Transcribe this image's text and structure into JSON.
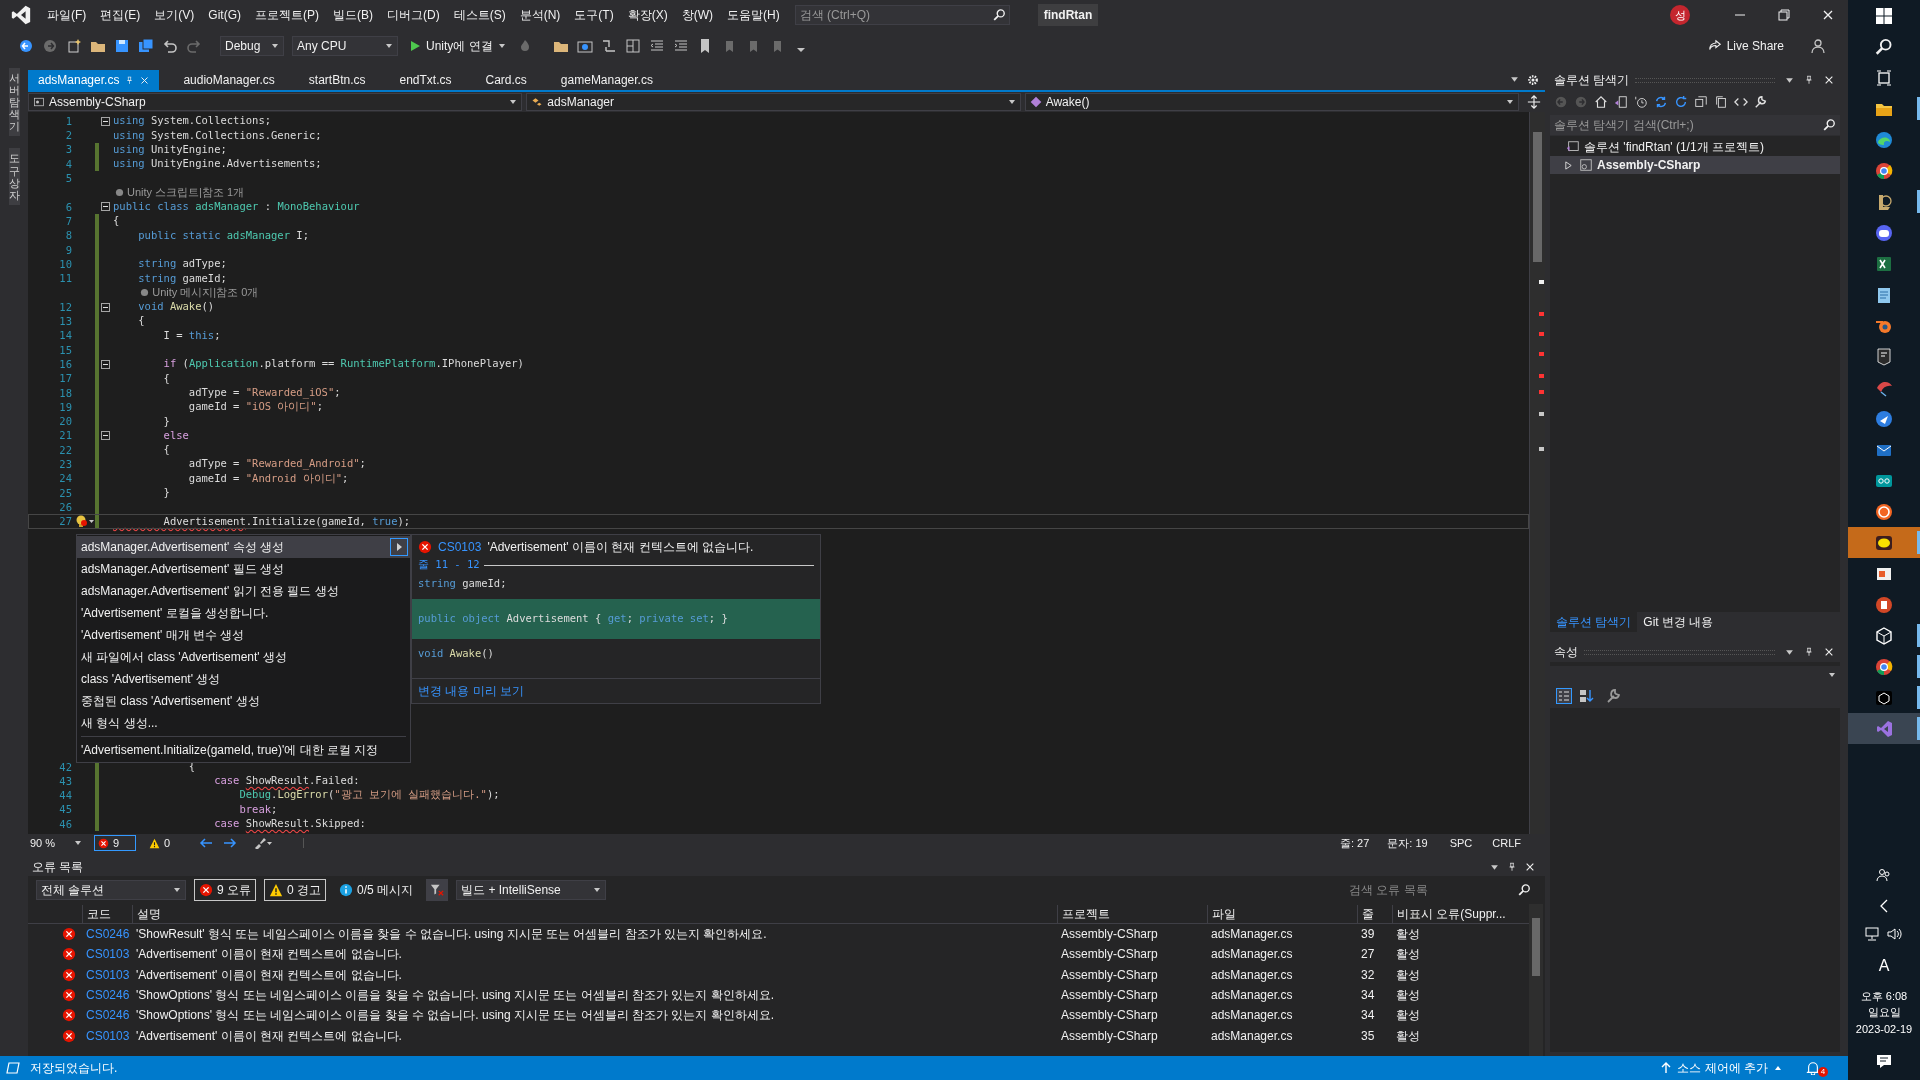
{
  "menu_bar": {
    "items": [
      "파일(F)",
      "편집(E)",
      "보기(V)",
      "Git(G)",
      "프로젝트(P)",
      "빌드(B)",
      "디버그(D)",
      "테스트(S)",
      "분석(N)",
      "도구(T)",
      "확장(X)",
      "창(W)",
      "도움말(H)"
    ],
    "search_placeholder": "검색 (Ctrl+Q)",
    "title": "findRtan",
    "avatar": "성"
  },
  "toolbar": {
    "configuration": "Debug",
    "platform": "Any CPU",
    "run": "Unity에 연결",
    "live_share": "Live Share"
  },
  "side_tabs": [
    "서버 탐색기",
    "도구 상자"
  ],
  "editor": {
    "tabs": [
      {
        "label": "adsManager.cs",
        "selected": true
      },
      {
        "label": "audioManager.cs",
        "selected": false
      },
      {
        "label": "startBtn.cs",
        "selected": false
      },
      {
        "label": "endTxt.cs",
        "selected": false
      },
      {
        "label": "Card.cs",
        "selected": false
      },
      {
        "label": "gameManager.cs",
        "selected": false
      }
    ],
    "nav": [
      "Assembly-CSharp",
      "adsManager",
      "Awake()"
    ],
    "code_top": [
      {
        "kind": "code",
        "number": "1",
        "changed": false,
        "fold": true,
        "tokens": [
          {
            "kind": "kw",
            "text": "using"
          },
          {
            "kind": "plain",
            "text": " System.Collections;"
          }
        ]
      },
      {
        "kind": "code",
        "number": "2",
        "changed": false,
        "fold": false,
        "tokens": [
          {
            "kind": "kw",
            "text": "using"
          },
          {
            "kind": "plain",
            "text": " System.Collections.Generic;"
          }
        ]
      },
      {
        "kind": "code",
        "number": "3",
        "changed": true,
        "fold": false,
        "tokens": [
          {
            "kind": "kw",
            "text": "using"
          },
          {
            "kind": "plain",
            "text": " UnityEngine;"
          }
        ]
      },
      {
        "kind": "code",
        "number": "4",
        "changed": true,
        "fold": false,
        "tokens": [
          {
            "kind": "kw",
            "text": "using"
          },
          {
            "kind": "plain",
            "text": " UnityEngine.Advertisements;"
          }
        ]
      },
      {
        "kind": "code",
        "number": "5",
        "changed": false,
        "fold": false
      },
      {
        "kind": "lens",
        "changed": false,
        "text": "Unity 스크립트|참조 1개"
      },
      {
        "kind": "code",
        "number": "6",
        "changed": false,
        "fold": true,
        "tokens": [
          {
            "kind": "kw",
            "text": "public class "
          },
          {
            "kind": "type",
            "text": "adsManager"
          },
          {
            "kind": "plain",
            "text": " : "
          },
          {
            "kind": "type",
            "text": "MonoBehaviour"
          }
        ]
      },
      {
        "kind": "code",
        "number": "7",
        "changed": true,
        "fold": false,
        "tokens": [
          {
            "kind": "plain",
            "text": "{"
          }
        ]
      },
      {
        "kind": "code",
        "number": "8",
        "changed": true,
        "fold": false,
        "tokens": [
          {
            "kind": "kw",
            "text": "    public static "
          },
          {
            "kind": "type",
            "text": "adsManager"
          },
          {
            "kind": "plain",
            "text": " I;"
          }
        ]
      },
      {
        "kind": "code",
        "number": "9",
        "changed": true,
        "fold": false
      },
      {
        "kind": "code",
        "number": "10",
        "changed": true,
        "fold": false,
        "tokens": [
          {
            "kind": "kw",
            "text": "    string"
          },
          {
            "kind": "plain",
            "text": " adType;"
          }
        ]
      },
      {
        "kind": "code",
        "number": "11",
        "changed": true,
        "fold": false,
        "tokens": [
          {
            "kind": "kw",
            "text": "    string"
          },
          {
            "kind": "plain",
            "text": " gameId;"
          }
        ]
      },
      {
        "kind": "lens",
        "changed": true,
        "text": "    Unity 메시지|참조 0개"
      },
      {
        "kind": "code",
        "number": "12",
        "changed": true,
        "fold": true,
        "tokens": [
          {
            "kind": "kw",
            "text": "    void "
          },
          {
            "kind": "fn",
            "text": "Awake"
          },
          {
            "kind": "plain",
            "text": "()"
          }
        ]
      },
      {
        "kind": "code",
        "number": "13",
        "changed": true,
        "fold": false,
        "tokens": [
          {
            "kind": "plain",
            "text": "    {"
          }
        ]
      },
      {
        "kind": "code",
        "number": "14",
        "changed": true,
        "fold": false,
        "tokens": [
          {
            "kind": "plain",
            "text": "        I = "
          },
          {
            "kind": "kw",
            "text": "this"
          },
          {
            "kind": "plain",
            "text": ";"
          }
        ]
      },
      {
        "kind": "code",
        "number": "15",
        "changed": true,
        "fold": false
      },
      {
        "kind": "code",
        "number": "16",
        "changed": true,
        "fold": true,
        "tokens": [
          {
            "kind": "ctl",
            "text": "        if"
          },
          {
            "kind": "plain",
            "text": " ("
          },
          {
            "kind": "type",
            "text": "Application"
          },
          {
            "kind": "plain",
            "text": ".platform == "
          },
          {
            "kind": "type",
            "text": "RuntimePlatform"
          },
          {
            "kind": "plain",
            "text": ".IPhonePlayer)"
          }
        ]
      },
      {
        "kind": "code",
        "number": "17",
        "changed": true,
        "fold": false,
        "tokens": [
          {
            "kind": "plain",
            "text": "        {"
          }
        ]
      },
      {
        "kind": "code",
        "number": "18",
        "changed": true,
        "fold": false,
        "tokens": [
          {
            "kind": "plain",
            "text": "            adType = "
          },
          {
            "kind": "str",
            "text": "\"Rewarded_iOS\""
          },
          {
            "kind": "plain",
            "text": ";"
          }
        ]
      },
      {
        "kind": "code",
        "number": "19",
        "changed": true,
        "fold": false,
        "tokens": [
          {
            "kind": "plain",
            "text": "            gameId = "
          },
          {
            "kind": "str",
            "text": "\"iOS 아이디\""
          },
          {
            "kind": "plain",
            "text": ";"
          }
        ]
      },
      {
        "kind": "code",
        "number": "20",
        "changed": true,
        "fold": false,
        "tokens": [
          {
            "kind": "plain",
            "text": "        }"
          }
        ]
      },
      {
        "kind": "code",
        "number": "21",
        "changed": true,
        "fold": true,
        "tokens": [
          {
            "kind": "ctl",
            "text": "        else"
          }
        ]
      },
      {
        "kind": "code",
        "number": "22",
        "changed": true,
        "fold": false,
        "tokens": [
          {
            "kind": "plain",
            "text": "        {"
          }
        ]
      },
      {
        "kind": "code",
        "number": "23",
        "changed": true,
        "fold": false,
        "tokens": [
          {
            "kind": "plain",
            "text": "            adType = "
          },
          {
            "kind": "str",
            "text": "\"Rewarded_Android\""
          },
          {
            "kind": "plain",
            "text": ";"
          }
        ]
      },
      {
        "kind": "code",
        "number": "24",
        "changed": true,
        "fold": false,
        "tokens": [
          {
            "kind": "plain",
            "text": "            gameId = "
          },
          {
            "kind": "str",
            "text": "\"Android 아이디\""
          },
          {
            "kind": "plain",
            "text": ";"
          }
        ]
      },
      {
        "kind": "code",
        "number": "25",
        "changed": true,
        "fold": false,
        "tokens": [
          {
            "kind": "plain",
            "text": "        }"
          }
        ]
      },
      {
        "kind": "code",
        "number": "26",
        "changed": true,
        "fold": false
      },
      {
        "kind": "code",
        "number": "27",
        "changed": true,
        "fold": false,
        "tokens": [
          {
            "kind": "err",
            "text": "        Advertisement"
          },
          {
            "kind": "plain",
            "text": ".Initialize(gameId, "
          },
          {
            "kind": "kw",
            "text": "true"
          },
          {
            "kind": "plain",
            "text": ");"
          }
        ]
      }
    ],
    "code_bottom": [
      {
        "kind": "code",
        "number": "42",
        "changed": true,
        "fold": false,
        "tokens": [
          {
            "kind": "plain",
            "text": "            {"
          }
        ]
      },
      {
        "kind": "code",
        "number": "43",
        "changed": true,
        "fold": false,
        "tokens": [
          {
            "kind": "ctl",
            "text": "                case "
          },
          {
            "kind": "err",
            "text": "ShowResult"
          },
          {
            "kind": "plain",
            "text": ".Failed:"
          }
        ]
      },
      {
        "kind": "code",
        "number": "44",
        "changed": true,
        "fold": false,
        "tokens": [
          {
            "kind": "type",
            "text": "                    Debug"
          },
          {
            "kind": "plain",
            "text": "."
          },
          {
            "kind": "fn",
            "text": "LogError"
          },
          {
            "kind": "plain",
            "text": "("
          },
          {
            "kind": "str",
            "text": "\"광고 보기에 실패했습니다.\""
          },
          {
            "kind": "plain",
            "text": ");"
          }
        ]
      },
      {
        "kind": "code",
        "number": "45",
        "changed": true,
        "fold": false,
        "tokens": [
          {
            "kind": "ctl",
            "text": "                    break"
          },
          {
            "kind": "plain",
            "text": ";"
          }
        ]
      },
      {
        "kind": "code",
        "number": "46",
        "changed": true,
        "fold": false,
        "tokens": [
          {
            "kind": "ctl",
            "text": "                case "
          },
          {
            "kind": "err",
            "text": "ShowResult"
          },
          {
            "kind": "plain",
            "text": ".Skipped:"
          }
        ]
      }
    ],
    "quick_actions": {
      "items": [
        {
          "label": "adsManager.Advertisement' 속성 생성",
          "selected": true
        },
        {
          "label": "adsManager.Advertisement' 필드 생성",
          "selected": false
        },
        {
          "label": "adsManager.Advertisement' 읽기 전용 필드 생성",
          "selected": false
        },
        {
          "label": "'Advertisement' 로컬을 생성합니다.",
          "selected": false
        },
        {
          "label": "'Advertisement' 매개 변수 생성",
          "selected": false
        },
        {
          "label": "새 파일에서 class 'Advertisement' 생성",
          "selected": false
        },
        {
          "label": "class 'Advertisement' 생성",
          "selected": false
        },
        {
          "label": "중첩된 class 'Advertisement' 생성",
          "selected": false
        },
        {
          "label": "새 형식 생성...",
          "selected": false
        }
      ],
      "footer_item": "'Advertisement.Initialize(gameId, true)'에 대한 로컬 지정",
      "preview": {
        "code": "CS0103",
        "message": "'Advertisement' 이름이 현재 컨텍스트에 없습니다.",
        "range": "줄 11 - 12",
        "lines": [
          {
            "added": false,
            "tokens": [
              {
                "kind": "kw",
                "text": "string"
              },
              {
                "kind": "plain",
                "text": " gameId;"
              }
            ]
          },
          {
            "added": true,
            "tokens": [
              {
                "kind": "kw",
                "text": "public object"
              },
              {
                "kind": "plain",
                "text": " Advertisement { "
              },
              {
                "kind": "kw",
                "text": "get"
              },
              {
                "kind": "plain",
                "text": "; "
              },
              {
                "kind": "kw",
                "text": "private set"
              },
              {
                "kind": "plain",
                "text": "; }"
              }
            ]
          },
          {
            "added": false,
            "tokens": [
              {
                "kind": "kw",
                "text": "void "
              },
              {
                "kind": "fn",
                "text": "Awake"
              },
              {
                "kind": "plain",
                "text": "()"
              }
            ]
          }
        ],
        "link": "변경 내용 미리 보기"
      }
    },
    "status": {
      "zoom": "90 %",
      "errors": "9",
      "warnings": "0",
      "line": "줄: 27",
      "column": "문자: 19",
      "spacing": "SPC",
      "line_ending": "CRLF"
    }
  },
  "error_list": {
    "title": "오류 목록",
    "scope": "전체 솔루션",
    "filters": [
      {
        "kind": "error",
        "label": "9 오류",
        "selected": true
      },
      {
        "kind": "warning",
        "label": "0 경고",
        "selected": true
      },
      {
        "kind": "info",
        "label": "0/5 메시지",
        "selected": false
      }
    ],
    "source": "빌드 + IntelliSense",
    "search_placeholder": "검색 오류 목록",
    "columns": [
      "코드",
      "설명",
      "프로젝트",
      "파일",
      "줄",
      "비표시 오류(Suppr..."
    ],
    "rows": [
      {
        "code": "CS0246",
        "description": "'ShowResult' 형식 또는 네임스페이스 이름을 찾을 수 없습니다. using 지시문 또는 어셈블리 참조가 있는지 확인하세요.",
        "project": "Assembly-CSharp",
        "file": "adsManager.cs",
        "line": "39",
        "suppression": "활성"
      },
      {
        "code": "CS0103",
        "description": "'Advertisement' 이름이 현재 컨텍스트에 없습니다.",
        "project": "Assembly-CSharp",
        "file": "adsManager.cs",
        "line": "27",
        "suppression": "활성"
      },
      {
        "code": "CS0103",
        "description": "'Advertisement' 이름이 현재 컨텍스트에 없습니다.",
        "project": "Assembly-CSharp",
        "file": "adsManager.cs",
        "line": "32",
        "suppression": "활성"
      },
      {
        "code": "CS0246",
        "description": "'ShowOptions' 형식 또는 네임스페이스 이름을 찾을 수 없습니다. using 지시문 또는 어셈블리 참조가 있는지 확인하세요.",
        "project": "Assembly-CSharp",
        "file": "adsManager.cs",
        "line": "34",
        "suppression": "활성"
      },
      {
        "code": "CS0246",
        "description": "'ShowOptions' 형식 또는 네임스페이스 이름을 찾을 수 없습니다. using 지시문 또는 어셈블리 참조가 있는지 확인하세요.",
        "project": "Assembly-CSharp",
        "file": "adsManager.cs",
        "line": "34",
        "suppression": "활성"
      },
      {
        "code": "CS0103",
        "description": "'Advertisement' 이름이 현재 컨텍스트에 없습니다.",
        "project": "Assembly-CSharp",
        "file": "adsManager.cs",
        "line": "35",
        "suppression": "활성"
      }
    ]
  },
  "solution_explorer": {
    "title": "솔루션 탐색기",
    "search_placeholder": "솔루션 탐색기 검색(Ctrl+;)",
    "tree": [
      {
        "label": "솔루션 'findRtan' (1/1개 프로젝트)",
        "selected": false,
        "children": [
          {
            "label": "Assembly-CSharp",
            "selected": true,
            "expanded": false
          }
        ]
      }
    ],
    "tabs": [
      {
        "label": "솔루션 탐색기",
        "selected": true
      },
      {
        "label": "Git 변경 내용",
        "selected": false
      }
    ]
  },
  "properties": {
    "title": "속성"
  },
  "status_bar": {
    "message": "저장되었습니다.",
    "source_control": "소스 제어에 추가",
    "notifications": "4"
  },
  "taskbar": {
    "apps": [
      {
        "kind": "folder",
        "running": true,
        "flashing": false,
        "selected": false
      },
      {
        "kind": "edge",
        "running": false,
        "flashing": false,
        "selected": false
      },
      {
        "kind": "chrome",
        "running": false,
        "flashing": false,
        "selected": false
      },
      {
        "kind": "league",
        "running": true,
        "flashing": false,
        "selected": false
      },
      {
        "kind": "discord",
        "running": false,
        "flashing": false,
        "selected": false
      },
      {
        "kind": "excel",
        "running": false,
        "flashing": false,
        "selected": false
      },
      {
        "kind": "notepad",
        "running": false,
        "flashing": false,
        "selected": false
      },
      {
        "kind": "blender",
        "running": false,
        "flashing": false,
        "selected": false
      },
      {
        "kind": "epic",
        "running": false,
        "flashing": false,
        "selected": false
      },
      {
        "kind": "kite",
        "running": false,
        "flashing": false,
        "selected": false
      },
      {
        "kind": "shuttle",
        "running": false,
        "flashing": false,
        "selected": false
      },
      {
        "kind": "mail",
        "running": false,
        "flashing": false,
        "selected": false
      },
      {
        "kind": "arduino",
        "running": false,
        "flashing": false,
        "selected": false
      },
      {
        "kind": "letter",
        "running": false,
        "flashing": false,
        "selected": false
      },
      {
        "kind": "chat",
        "running": true,
        "flashing": true,
        "selected": false
      },
      {
        "kind": "slides",
        "running": false,
        "flashing": false,
        "selected": false
      },
      {
        "kind": "powerpoint",
        "running": false,
        "flashing": false,
        "selected": false
      },
      {
        "kind": "cube",
        "running": true,
        "flashing": false,
        "selected": false
      },
      {
        "kind": "chrome",
        "running": true,
        "flashing": false,
        "selected": false
      },
      {
        "kind": "unityhub",
        "running": true,
        "flashing": false,
        "selected": false
      },
      {
        "kind": "visualstudio",
        "running": true,
        "flashing": false,
        "selected": true
      }
    ],
    "ime": "A",
    "time": "오후 6:08",
    "day": "일요일",
    "date": "2023-02-19"
  }
}
